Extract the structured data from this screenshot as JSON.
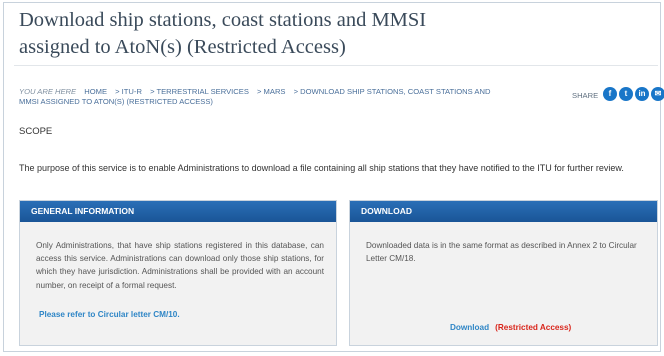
{
  "page": {
    "title": "Download ship stations, coast stations and MMSI assigned to AtoN(s) (Restricted Access)"
  },
  "breadcrumb": {
    "you_are_here": "YOU ARE HERE",
    "items": [
      "HOME",
      "> ITU-R",
      "> TERRESTRIAL SERVICES",
      "> MARS",
      "> DOWNLOAD SHIP STATIONS, COAST STATIONS AND MMSI ASSIGNED TO ATON(S) (RESTRICTED ACCESS)"
    ]
  },
  "share": {
    "label": "SHARE",
    "icons": [
      "facebook-icon",
      "twitter-icon",
      "linkedin-icon",
      "email-icon"
    ],
    "color": "#1976c8"
  },
  "scope": {
    "heading": "SCOPE",
    "text": "The purpose of this service is to enable Administrations to download a file containing all ship stations that they have notified to the ITU for further review."
  },
  "general": {
    "heading": "GENERAL INFORMATION",
    "body": "Only Administrations, that have ship stations registered in this database, can access this service. Administrations can download only those ship stations, for which they have jurisdiction. Administrations shall be provided with an account number, on receipt of a formal request.",
    "link": "Please refer to Circular letter CM/10."
  },
  "download": {
    "heading": "DOWNLOAD",
    "body": "Downloaded data is in the same format as described in Annex 2 to Circular Letter CM/18.",
    "link": "Download",
    "restricted": "(Restricted Access)"
  },
  "colors": {
    "panel_header": "#1a5597",
    "link": "#2f86c6",
    "restricted": "#d9261c"
  }
}
